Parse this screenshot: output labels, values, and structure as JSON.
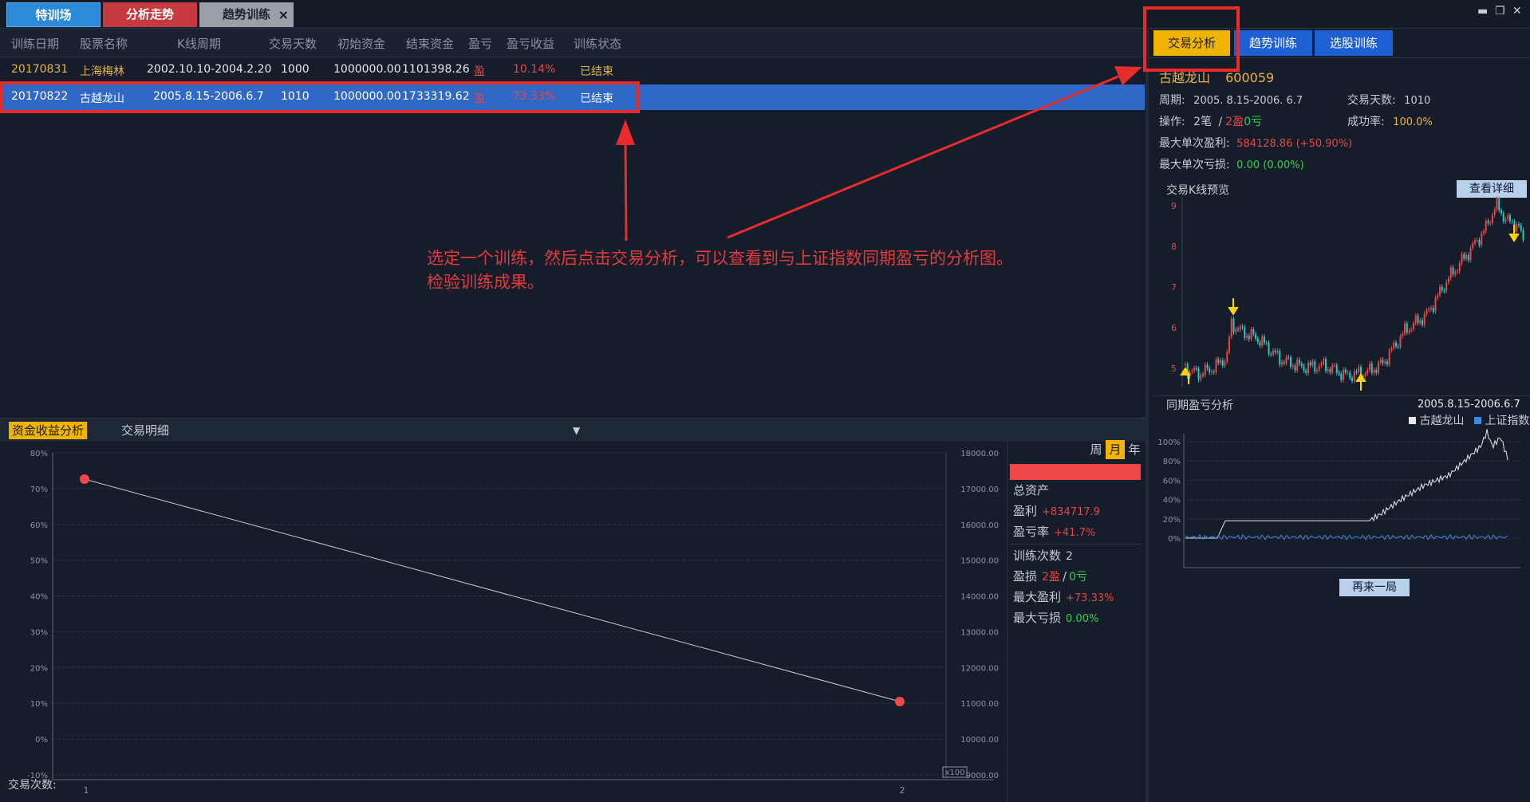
{
  "tabs": {
    "training_ground": "特训场",
    "analysis_trend": "分析走势",
    "trend_training": "趋势训练",
    "close": "×"
  },
  "window_controls": {
    "minimize": "▬",
    "restore": "❐",
    "close": "✕"
  },
  "table": {
    "headers": [
      "训练日期",
      "股票名称",
      "K线周期",
      "交易天数",
      "初始资金",
      "结束资金",
      "盈亏",
      "盈亏收益",
      "训练状态"
    ],
    "rows": [
      {
        "date": "20170831",
        "name": "上海梅林",
        "period": "2002.10.10-2004.2.20",
        "days": "1000",
        "init": "1000000.00",
        "final": "1101398.26",
        "pl": "盈",
        "ret": "10.14%",
        "status": "已结束"
      },
      {
        "date": "20170822",
        "name": "古越龙山",
        "period": "2005.8.15-2006.6.7",
        "days": "1010",
        "init": "1000000.00",
        "final": "1733319.62",
        "pl": "盈",
        "ret": "73.33%",
        "status": "已结束"
      }
    ]
  },
  "annotation": {
    "line1": "选定一个训练，然后点击交易分析，可以查看到与上证指数同期盈亏的分析图。",
    "line2": "检验训练成果。"
  },
  "bottom_tabs": {
    "fund_analysis": "资金收益分析",
    "trade_detail": "交易明细",
    "dropdown": "▼"
  },
  "fund_chart": {
    "left_ticks": [
      "80%",
      "70%",
      "60%",
      "50%",
      "40%",
      "30%",
      "20%",
      "10%",
      "0%",
      "-10%"
    ],
    "right_ticks": [
      "18000.00",
      "17000.00",
      "16000.00",
      "15000.00",
      "14000.00",
      "13000.00",
      "12000.00",
      "11000.00",
      "10000.00",
      "9000.00"
    ],
    "x_ticks": [
      "1",
      "2"
    ],
    "x_label": "交易次数:",
    "x_unit": "x100"
  },
  "period_buttons": {
    "week": "周",
    "month": "月",
    "year": "年"
  },
  "summary": {
    "total_assets": "总资产",
    "profit_label": "盈利",
    "profit_value": "+834717.9",
    "rate_label": "盈亏率",
    "rate_value": "+41.7%",
    "count_label": "训练次数",
    "count_value": "2",
    "wl_label": "盈损",
    "wins": "2盈",
    "sep": "/",
    "losses": "0亏",
    "max_profit_label": "最大盈利",
    "max_profit_value": "+73.33%",
    "max_loss_label": "最大亏损",
    "max_loss_value": "0.00%"
  },
  "right_tabs": {
    "trade_analysis": "交易分析",
    "trend_training": "趋势训练",
    "stock_training": "选股训练"
  },
  "stock": {
    "name": "古越龙山",
    "code": "600059",
    "period_label": "周期:",
    "period_value": "2005. 8.15-2006. 6.7",
    "days_label": "交易天数:",
    "days_value": "1010",
    "ops_label": "操作:",
    "ops_value": "2笔",
    "ops_sep": "/",
    "ops_win": "2盈",
    "ops_loss": "0亏",
    "success_label": "成功率:",
    "success_value": "100.0%",
    "max_win_label": "最大单次盈利:",
    "max_win_value": "584128.86 (+50.90%)",
    "max_loss_label": "最大单次亏损:",
    "max_loss_value": "0.00 (0.00%)"
  },
  "kline": {
    "title": "交易K线预览",
    "detail_button": "查看详细",
    "y_ticks": [
      "9",
      "8",
      "7",
      "6",
      "5"
    ]
  },
  "compare": {
    "title": "同期盈亏分析",
    "period": "2005.8.15-2006.6.7",
    "legend_stock": "古越龙山",
    "legend_index": "上证指数",
    "y_ticks": [
      "100%",
      "80%",
      "60%",
      "40%",
      "20%",
      "0%"
    ],
    "replay_button": "再来一局"
  }
}
